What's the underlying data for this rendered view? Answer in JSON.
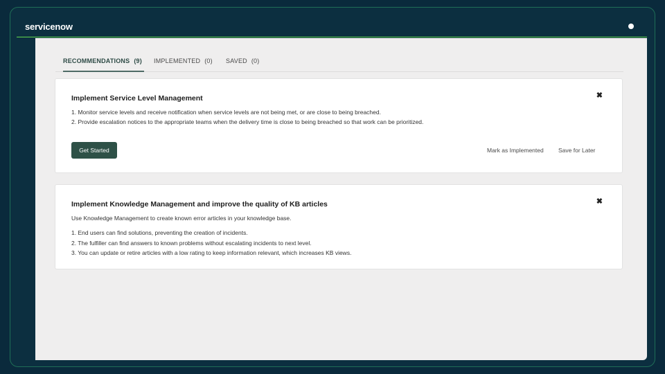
{
  "header": {
    "logo_text": "servicenow"
  },
  "tabs": [
    {
      "label": "RECOMMENDATIONS",
      "count": "(9)"
    },
    {
      "label": "IMPLEMENTED",
      "count": "(0)"
    },
    {
      "label": "SAVED",
      "count": "(0)"
    }
  ],
  "cards": [
    {
      "title": "Implement Service Level Management",
      "lines": [
        "1. Monitor service levels and receive notification when service levels are not being met, or are close to being breached.",
        "2. Provide escalation notices to the appropriate teams when the delivery time is close to being breached so that work can be prioritized."
      ],
      "primary_button": "Get Started",
      "mark_implemented": "Mark as Implemented",
      "save_later": "Save for Later",
      "close_glyph": "✖"
    },
    {
      "title": "Implement Knowledge Management and improve the quality of KB articles",
      "intro": "Use Knowledge Management to create known error articles in your knowledge base.",
      "lines": [
        "1. End users can find solutions, preventing the creation of incidents.",
        "2. The fulfiller can find answers to known problems without escalating incidents to next level.",
        "3. You can update or retire articles with a low rating to keep information relevant, which increases KB views."
      ],
      "close_glyph": "✖"
    }
  ],
  "colors": {
    "accent": "#62d84e",
    "primary_button": "#2e5147",
    "background": "#0a2a3c"
  }
}
